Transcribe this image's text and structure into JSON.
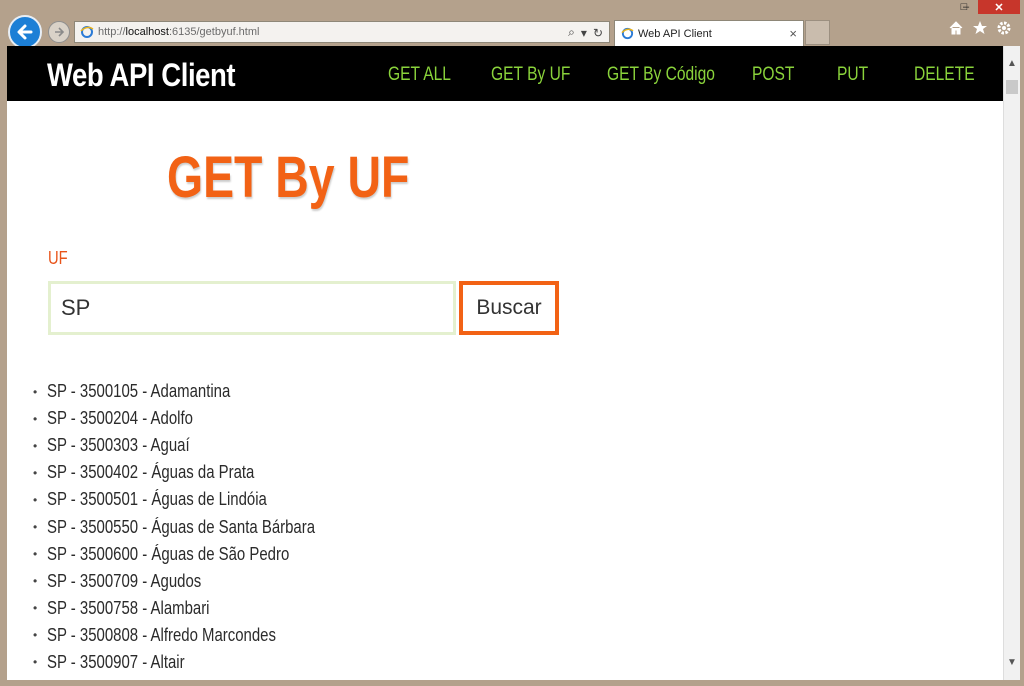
{
  "browser": {
    "url_prefix": "http://",
    "url_host": "localhost",
    "url_rest": ":6135/getbyuf.html",
    "tab_title": "Web API Client",
    "tab_close": "×",
    "window": {
      "minimize": "–",
      "maximize": "□",
      "close": "✕"
    }
  },
  "nav": {
    "brand": "Web API Client",
    "links": [
      "GET ALL",
      "GET By UF",
      "GET By Código",
      "POST",
      "PUT",
      "DELETE"
    ]
  },
  "page": {
    "title": "GET By UF",
    "uf_label": "UF",
    "uf_value": "SP",
    "search_button": "Buscar"
  },
  "results": [
    "SP - 3500105 - Adamantina",
    "SP - 3500204 - Adolfo",
    "SP - 3500303 - Aguaí",
    "SP - 3500402 - Águas da Prata",
    "SP - 3500501 - Águas de Lindóia",
    "SP - 3500550 - Águas de Santa Bárbara",
    "SP - 3500600 - Águas de São Pedro",
    "SP - 3500709 - Agudos",
    "SP - 3500758 - Alambari",
    "SP - 3500808 - Alfredo Marcondes",
    "SP - 3500907 - Altair"
  ],
  "colors": {
    "accent": "#f26215",
    "nav_link": "#8ad33b",
    "navbar_bg": "#000000"
  }
}
